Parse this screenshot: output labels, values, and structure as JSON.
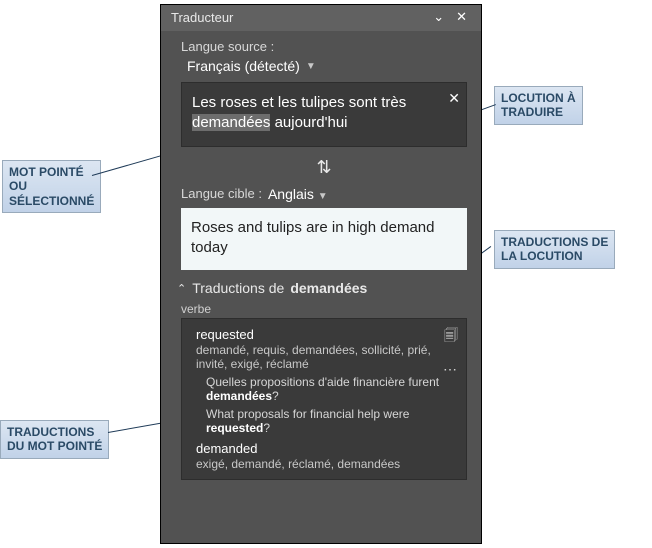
{
  "titlebar": {
    "title": "Traducteur"
  },
  "source": {
    "label": "Langue source :",
    "language": "Français (détecté)",
    "text_pre": "Les roses et les tulipes sont très ",
    "text_hl": "demandées",
    "text_post": " aujourd'hui"
  },
  "target": {
    "label": "Langue cible :",
    "language": "Anglais",
    "result": "Roses and tulips are in high demand today"
  },
  "word": {
    "header_prefix": "Traductions de ",
    "word": "demandées",
    "pos": "verbe",
    "entries": [
      {
        "headword": "requested",
        "synonyms": "demandé, requis, demandées, sollicité, prié, invité, exigé, réclamé",
        "example_src_pre": "Quelles propositions d'aide financière furent ",
        "example_src_b": "demandées",
        "example_src_post": "?",
        "example_tgt_pre": "What proposals for financial help were ",
        "example_tgt_b": "requested",
        "example_tgt_post": "?"
      },
      {
        "headword": "demanded",
        "synonyms": "exigé, demandé, réclamé, demandées"
      }
    ]
  },
  "callouts": {
    "mot_pointe": "MOT POINTÉ\nOU\nSÉLECTIONNÉ",
    "locution": "LOCUTION À\nTRADUIRE",
    "trad_loc": "TRADUCTIONS DE\nLA LOCUTION",
    "trad_mot": "TRADUCTIONS\nDU MOT POINTÉ"
  }
}
